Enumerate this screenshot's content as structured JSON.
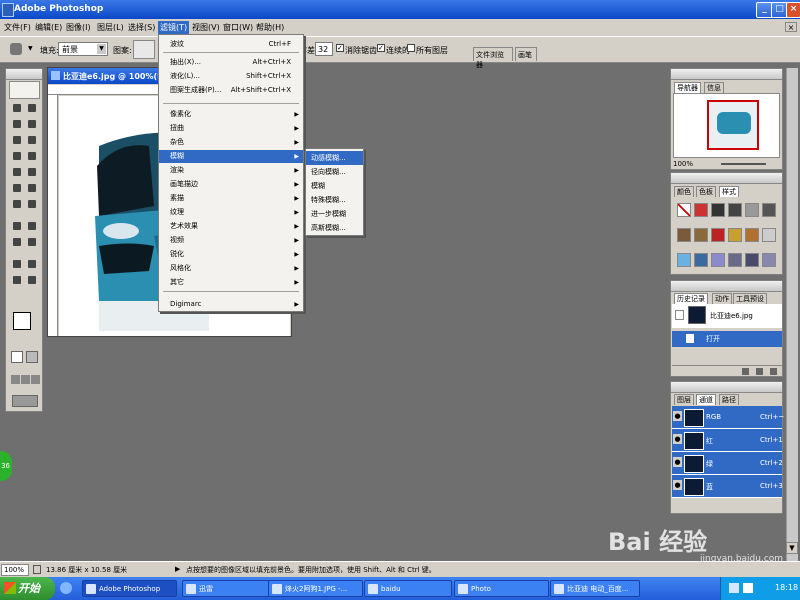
{
  "app": {
    "title": "Adobe Photoshop"
  },
  "menubar": {
    "items": [
      "文件(F)",
      "编辑(E)",
      "图像(I)",
      "图层(L)",
      "选择(S)",
      "滤镜(T)",
      "视图(V)",
      "窗口(W)",
      "帮助(H)"
    ]
  },
  "options": {
    "fill_label": "填充:",
    "fill_value": "前景",
    "pattern_label": "图案:",
    "tolerance_label": "容差:",
    "tolerance_value": "32",
    "antialias_label": "消除锯齿",
    "contiguous_label": "连续的",
    "all_layers_label": "所有图层",
    "file_browser": "文件浏览器",
    "brushes": "画笔"
  },
  "document": {
    "title": "比亚迪e6.jpg @ 100%(R..."
  },
  "filter_menu": {
    "items": [
      {
        "label": "波纹",
        "shortcut": "Ctrl+F"
      },
      {
        "label": "抽出(X)...",
        "shortcut": "Alt+Ctrl+X"
      },
      {
        "label": "液化(L)...",
        "shortcut": "Shift+Ctrl+X"
      },
      {
        "label": "图案生成器(P)...",
        "shortcut": "Alt+Shift+Ctrl+X"
      },
      {
        "label": "像素化"
      },
      {
        "label": "扭曲"
      },
      {
        "label": "杂色"
      },
      {
        "label": "模糊"
      },
      {
        "label": "渲染"
      },
      {
        "label": "画笔描边"
      },
      {
        "label": "素描"
      },
      {
        "label": "纹理"
      },
      {
        "label": "艺术效果"
      },
      {
        "label": "视频"
      },
      {
        "label": "锐化"
      },
      {
        "label": "风格化"
      },
      {
        "label": "其它"
      },
      {
        "label": "Digimarc"
      }
    ]
  },
  "blur_submenu": {
    "items": [
      "动感模糊...",
      "径向模糊...",
      "模糊",
      "特殊模糊...",
      "进一步模糊",
      "高斯模糊..."
    ]
  },
  "navigator": {
    "tabs": [
      "导航器",
      "信息"
    ],
    "zoom": "100%"
  },
  "color_panel": {
    "tabs": [
      "颜色",
      "色板",
      "样式"
    ]
  },
  "history_panel": {
    "tabs": [
      "历史记录",
      "动作",
      "工具预设"
    ],
    "snapshot": "比亚迪e6.jpg",
    "step": "打开"
  },
  "layers_panel": {
    "tabs": [
      "图层",
      "通道",
      "路径"
    ],
    "channels": [
      {
        "name": "RGB",
        "shortcut": "Ctrl+~"
      },
      {
        "name": "红",
        "shortcut": "Ctrl+1"
      },
      {
        "name": "绿",
        "shortcut": "Ctrl+2"
      },
      {
        "name": "蓝",
        "shortcut": "Ctrl+3"
      }
    ]
  },
  "statusbar": {
    "zoom": "100%",
    "size": "13.86 厘米 x 10.58 厘米",
    "hint": "点按想要的图像区域以填充前景色。要用附加选项，使用 Shift、Alt 和 Ctrl 键。"
  },
  "badge": "36",
  "watermark": {
    "text": "Bai 经验",
    "url": "jingyan.baidu.com"
  },
  "taskbar": {
    "start": "开始",
    "buttons": [
      "Adobe Photoshop",
      "迅雷",
      "烽火2阿狗1.JPG -...",
      "baidu",
      "Photo",
      "比亚迪 电动_百度..."
    ],
    "clock": "18:18"
  }
}
